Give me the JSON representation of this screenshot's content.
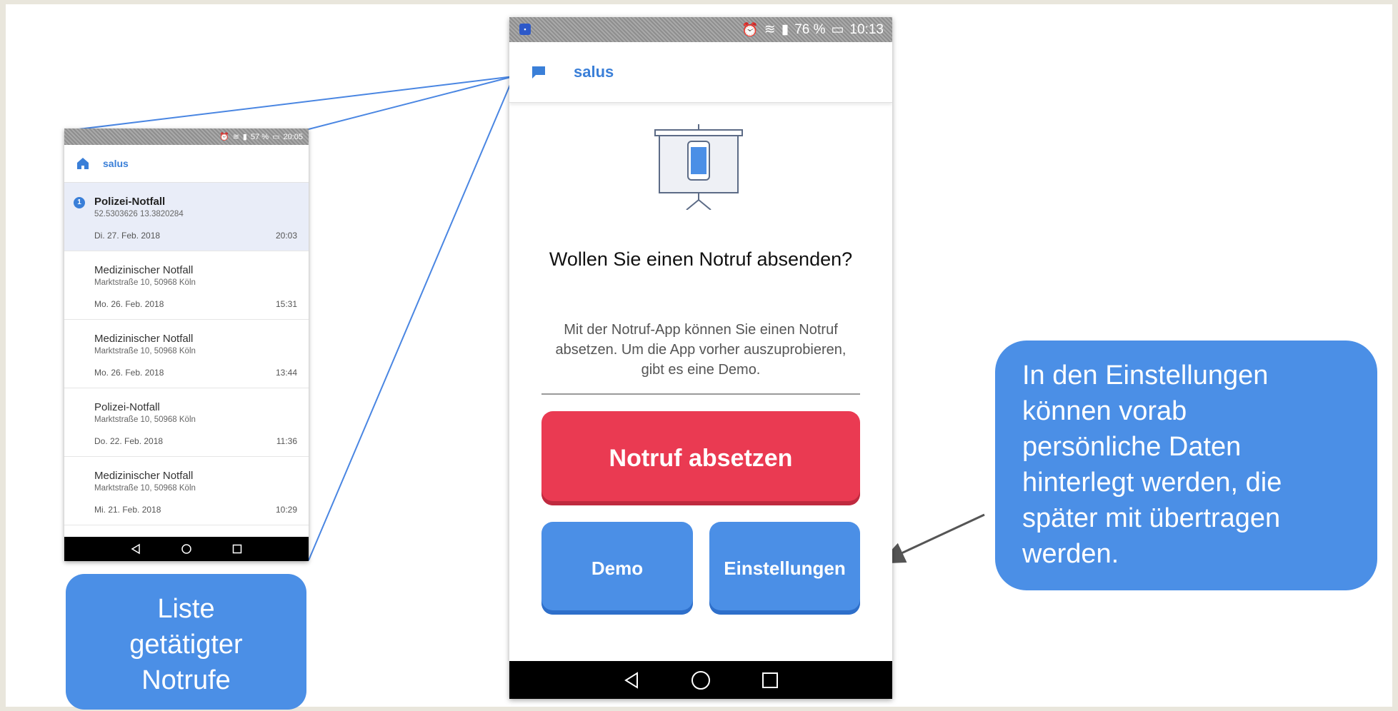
{
  "small_phone": {
    "status_text": "57 %",
    "clock": "20:05",
    "brand": "salus",
    "badge_count": "1",
    "items": [
      {
        "title": "Polizei-Notfall",
        "addr": "52.5303626 13.3820284",
        "date": "Di. 27. Feb. 2018",
        "time": "20:03"
      },
      {
        "title": "Medizinischer Notfall",
        "addr": "Marktstraße 10, 50968 Köln",
        "date": "Mo. 26. Feb. 2018",
        "time": "15:31"
      },
      {
        "title": "Medizinischer Notfall",
        "addr": "Marktstraße 10, 50968 Köln",
        "date": "Mo. 26. Feb. 2018",
        "time": "13:44"
      },
      {
        "title": "Polizei-Notfall",
        "addr": "Marktstraße 10, 50968 Köln",
        "date": "Do. 22. Feb. 2018",
        "time": "11:36"
      },
      {
        "title": "Medizinischer Notfall",
        "addr": "Marktstraße 10, 50968 Köln",
        "date": "Mi. 21. Feb. 2018",
        "time": "10:29"
      }
    ]
  },
  "main_phone": {
    "battery": "76 %",
    "clock": "10:13",
    "brand": "salus",
    "question": "Wollen Sie einen Notruf absenden?",
    "info": "Mit der Notruf-App können Sie einen Notruf absetzen. Um die App vorher auszuprobieren, gibt es eine Demo.",
    "emergency_button": "Notruf absetzen",
    "demo_button": "Demo",
    "settings_button": "Einstellungen"
  },
  "callouts": {
    "left_lines": [
      "Liste",
      "getätigter",
      "Notrufe"
    ],
    "right_lines": [
      "In den Einstellungen",
      "können vorab",
      "persönliche Daten",
      "hinterlegt werden, die",
      "später mit übertragen",
      "werden."
    ]
  },
  "colors": {
    "accent_blue": "#4b8fe6",
    "brand_blue": "#3a7fd8",
    "emergency_red": "#ea3a52",
    "background": "#e9e6dc"
  }
}
